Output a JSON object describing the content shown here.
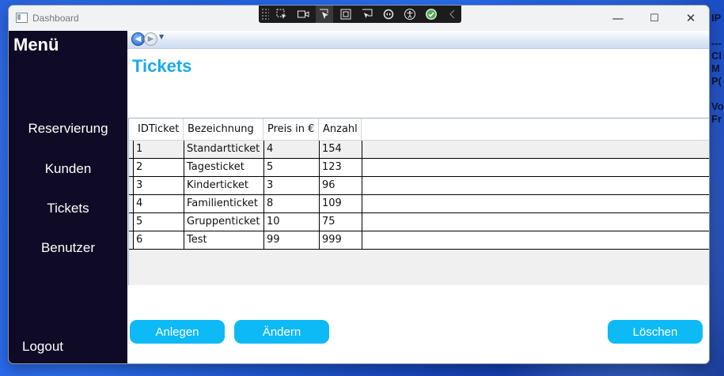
{
  "window": {
    "title": "Dashboard"
  },
  "window_controls": {
    "minimize": "—",
    "maximize": "☐",
    "close": "✕"
  },
  "debug_toolbar": {
    "icons": [
      "select-element-icon",
      "video-icon",
      "pointer-icon",
      "layout-adorner-icon",
      "track-focus-icon",
      "hot-reload-icon",
      "accessibility-icon",
      "check-icon",
      "collapse-chevron-icon"
    ]
  },
  "desktop_side_text": [
    "IP",
    "",
    "---",
    "Cl",
    "M",
    "P(",
    "",
    "Vo",
    "Fr"
  ],
  "sidebar": {
    "title": "Menü",
    "items": [
      {
        "label": "Reservierung"
      },
      {
        "label": "Kunden"
      },
      {
        "label": "Tickets"
      },
      {
        "label": "Benutzer"
      }
    ],
    "logout": "Logout"
  },
  "navigation": {
    "back": "◀",
    "forward": "▶",
    "dropdown": "▼"
  },
  "page": {
    "title": "Tickets"
  },
  "table": {
    "columns": [
      "IDTicket",
      "Bezeichnung",
      "Preis in €",
      "Anzahl"
    ],
    "rows": [
      [
        "1",
        "Standartticket",
        "4",
        "154"
      ],
      [
        "2",
        "Tagesticket",
        "5",
        "123"
      ],
      [
        "3",
        "Kinderticket",
        "3",
        "96"
      ],
      [
        "4",
        "Familienticket",
        "8",
        "109"
      ],
      [
        "5",
        "Gruppenticket",
        "10",
        "75"
      ],
      [
        "6",
        "Test",
        "99",
        "999"
      ]
    ]
  },
  "actions": {
    "create": "Anlegen",
    "edit": "Ändern",
    "delete": "Löschen"
  },
  "colors": {
    "accent": "#0DBAF5",
    "title": "#1AABEA",
    "sidebar": "#0F0A25"
  }
}
